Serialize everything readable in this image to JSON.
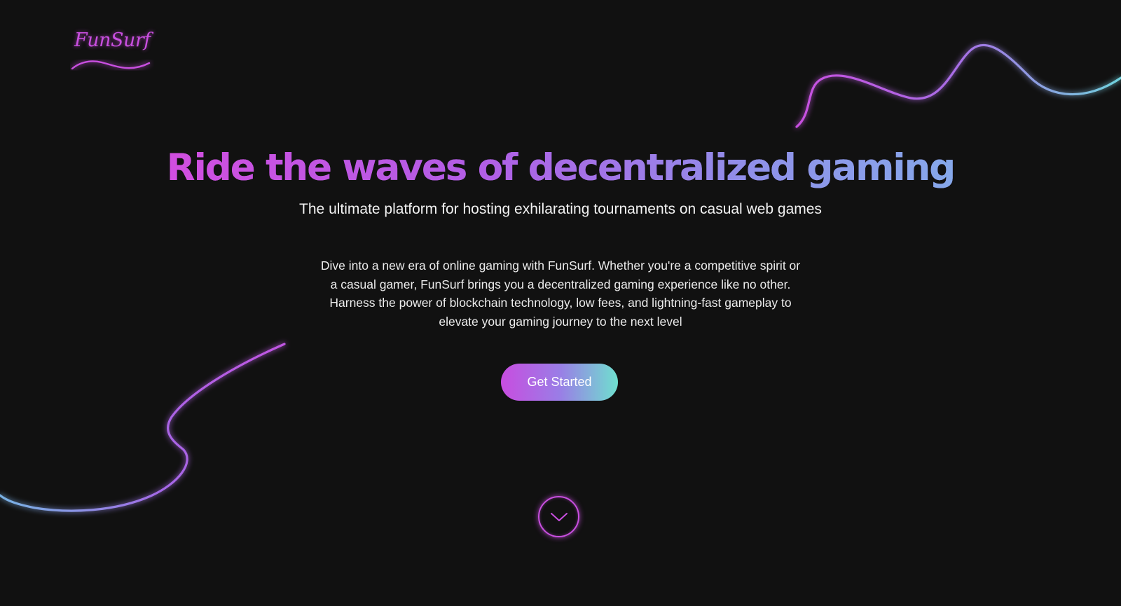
{
  "brand": {
    "logo_text": "FunSurf",
    "colors": {
      "background": "#111111",
      "accent_pink": "#c94fe0",
      "accent_purple": "#a863e6",
      "accent_blue": "#86a8ea",
      "accent_teal": "#6fe0cf"
    }
  },
  "hero": {
    "title": "Ride the waves of decentralized gaming",
    "subtitle": "The ultimate platform for hosting exhilarating tournaments on casual web games",
    "description_lines": [
      "Dive into a new era of online gaming with FunSurf. Whether you're a competitive spirit or",
      "a casual gamer, FunSurf brings you a decentralized gaming experience like no other.",
      "Harness the power of blockchain technology, low fees, and lightning-fast gameplay to",
      "elevate your gaming journey to the next level"
    ],
    "cta_label": "Get Started"
  },
  "scroll": {
    "icon": "chevron-down-icon"
  }
}
